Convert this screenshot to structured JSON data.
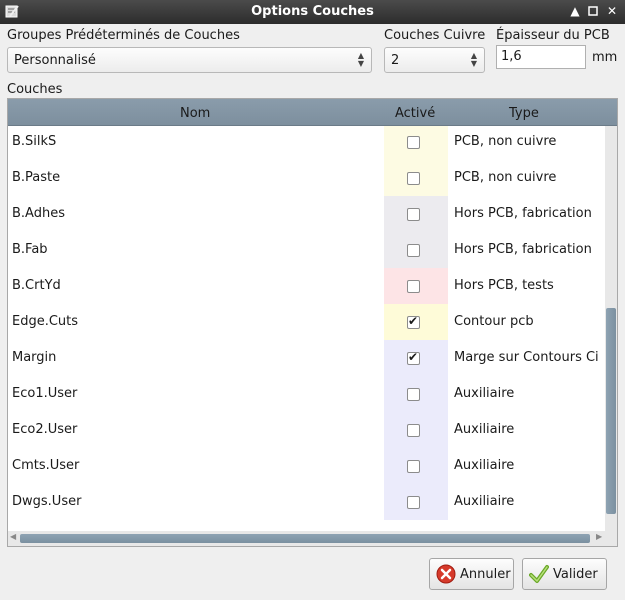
{
  "window": {
    "title": "Options Couches"
  },
  "presets": {
    "label": "Groupes Prédéterminés de Couches",
    "value": "Personnalisé"
  },
  "copper": {
    "label": "Couches Cuivre",
    "value": "2"
  },
  "thickness": {
    "label": "Épaisseur du PCB",
    "value": "1,6",
    "unit": "mm"
  },
  "layers": {
    "label": "Couches",
    "columns": {
      "name": "Nom",
      "active": "Activé",
      "type": "Type"
    },
    "rows": [
      {
        "name": "B.SilkS",
        "active": false,
        "type": "PCB, non cuivre",
        "color": "#fdfbe3"
      },
      {
        "name": "B.Paste",
        "active": false,
        "type": "PCB, non cuivre",
        "color": "#fdfbe3"
      },
      {
        "name": "B.Adhes",
        "active": false,
        "type": "Hors PCB, fabrication",
        "color": "#ecebef"
      },
      {
        "name": "B.Fab",
        "active": false,
        "type": "Hors PCB, fabrication",
        "color": "#ecebef"
      },
      {
        "name": "B.CrtYd",
        "active": false,
        "type": "Hors PCB, tests",
        "color": "#fde4e6"
      },
      {
        "name": "Edge.Cuts",
        "active": true,
        "type": "Contour pcb",
        "color": "#fefbd8"
      },
      {
        "name": "Margin",
        "active": true,
        "type": "Marge sur Contours Ci",
        "color": "#ebebfb"
      },
      {
        "name": "Eco1.User",
        "active": false,
        "type": "Auxiliaire",
        "color": "#ebebfb"
      },
      {
        "name": "Eco2.User",
        "active": false,
        "type": "Auxiliaire",
        "color": "#ebebfb"
      },
      {
        "name": "Cmts.User",
        "active": false,
        "type": "Auxiliaire",
        "color": "#ebebfb"
      },
      {
        "name": "Dwgs.User",
        "active": false,
        "type": "Auxiliaire",
        "color": "#ebebfb"
      }
    ]
  },
  "buttons": {
    "cancel": "Annuler",
    "ok": "Valider"
  },
  "icons": {
    "app": "layers-dialog-icon",
    "pin": "pin-up-icon",
    "maximize": "maximize-icon",
    "close": "close-icon"
  }
}
